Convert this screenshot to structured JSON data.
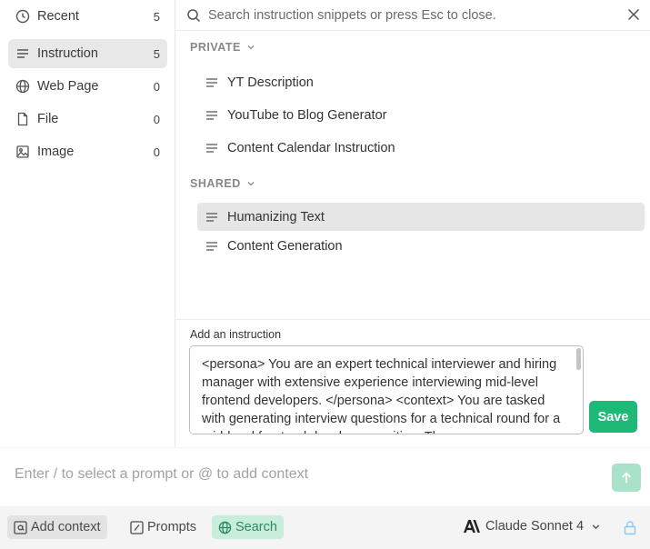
{
  "sidebar": {
    "items": [
      {
        "label": "Recent",
        "count": "5",
        "icon": "clock-icon"
      },
      {
        "label": "Instruction",
        "count": "5",
        "icon": "lines-icon"
      },
      {
        "label": "Web Page",
        "count": "0",
        "icon": "globe-icon"
      },
      {
        "label": "File",
        "count": "0",
        "icon": "file-icon"
      },
      {
        "label": "Image",
        "count": "0",
        "icon": "image-icon"
      }
    ]
  },
  "search": {
    "placeholder": "Search instruction snippets or press Esc to close."
  },
  "groups": {
    "private": {
      "title": "PRIVATE",
      "items": [
        "YT Description",
        "YouTube to Blog Generator",
        "Content Calendar Instruction"
      ]
    },
    "shared": {
      "title": "SHARED",
      "items": [
        "Humanizing Text",
        "Content Generation"
      ]
    }
  },
  "add_instruction": {
    "label": "Add an instruction",
    "value": "<persona> You are an expert technical interviewer and hiring manager with extensive experience interviewing mid-level frontend developers. </persona> <context> You are tasked with generating interview questions for a technical round for a mid-level frontend developer position. The",
    "save_label": "Save"
  },
  "prompt": {
    "placeholder": "Enter / to select a prompt or @ to add context"
  },
  "toolbar": {
    "add_context": "Add context",
    "prompts": "Prompts",
    "search": "Search",
    "model": "Claude Sonnet 4"
  },
  "colors": {
    "accent": "#1fb977",
    "send_disabled": "#a9e2c8",
    "search_active_bg": "#c9eddb",
    "lock": "#8cc7f0"
  }
}
